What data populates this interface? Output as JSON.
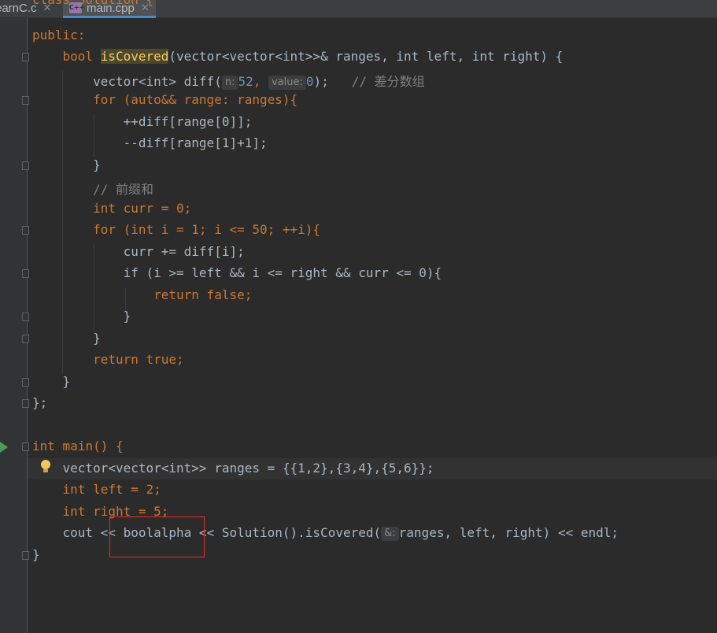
{
  "tabs": [
    {
      "label": "earnC.c",
      "active": false
    },
    {
      "label": "main.cpp",
      "active": true
    }
  ],
  "editor": {
    "partial_top": "class Solution {",
    "public_kw": "public:",
    "func_sig": {
      "ret": "bool",
      "name": "isCovered",
      "params": "(vector<vector<int>>& ranges, int left, int right) {"
    },
    "diff_decl": {
      "type": "vector<int> diff(",
      "hint_n": "n:",
      "n_val": "52",
      "hint_value": "value:",
      "value_val": "0",
      "end": ");",
      "comment": "// 差分数组"
    },
    "for1": "for (auto&& range: ranges){",
    "inc_line": "++diff[range[0]];",
    "dec_line": "--diff[range[1]+1];",
    "close1": "}",
    "comment_prefix": "// 前缀和",
    "curr_decl": "int curr = 0;",
    "for2": "for (int i = 1; i <= 50; ++i){",
    "curr_add": "curr += diff[i];",
    "if_line": "if (i >= left && i <= right && curr <= 0){",
    "return_false": "return false;",
    "close_if": "}",
    "close_for": "}",
    "return_true": "return true;",
    "close_func": "}",
    "close_class": "};",
    "main_sig": "int main() {",
    "ranges_decl": "vector<vector<int>> ranges = {{1,2},{3,4},{5,6}};",
    "left_decl": "int left = 2;",
    "right_decl": "int right = 5;",
    "cout_line": {
      "a": "cout << ",
      "b": "boolalpha",
      "c": " << Solution().isCovered(",
      "hint": "&:",
      "d": "ranges, left, right) << endl;"
    },
    "close_main": "}"
  },
  "colors": {
    "keyword": "#cc7832",
    "number": "#6897bb",
    "comment": "#808080",
    "function": "#ffc66d",
    "text": "#a9b7c6",
    "annotation_box": "#e0312a"
  }
}
